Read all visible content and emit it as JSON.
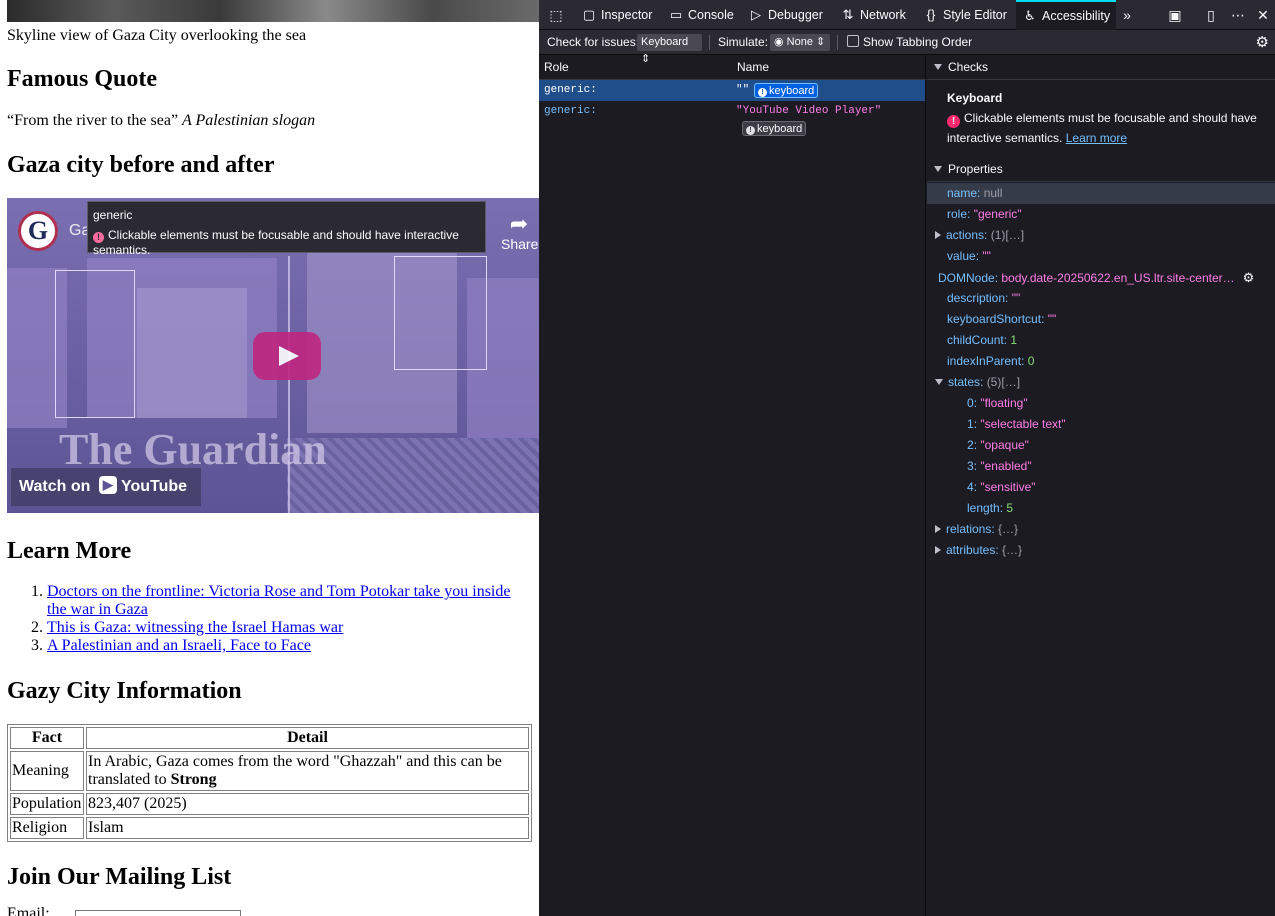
{
  "page": {
    "caption": "Skyline view of Gaza City overlooking the sea",
    "quote_heading": "Famous Quote",
    "quote_text": "“From the river to the sea”",
    "quote_attr": "A Palestinian slogan",
    "video_heading": "Gaza city before and after",
    "video": {
      "channel_letter": "G",
      "channel_name": "Ga",
      "share_label": "Share",
      "watermark": "The Guardian",
      "watch_on": "Watch on",
      "youtube": "YouTube"
    },
    "tooltip": {
      "title": "generic",
      "message": "Clickable elements must be focusable and should have interactive semantics."
    },
    "learn_heading": "Learn More",
    "links": [
      "Doctors on the frontline: Victoria Rose and Tom Potokar take you inside the war in Gaza",
      "This is Gaza: witnessing the Israel Hamas war",
      "A Palestinian and an Israeli, Face to Face"
    ],
    "info_heading": "Gazy City Information",
    "table": {
      "headers": [
        "Fact",
        "Detail"
      ],
      "rows": [
        {
          "fact": "Meaning",
          "detail": "In Arabic, Gaza comes from the word \"Ghazzah\" and this can be translated to ",
          "detail_bold": "Strong"
        },
        {
          "fact": "Population",
          "detail": "823,407 (2025)",
          "detail_bold": ""
        },
        {
          "fact": "Religion",
          "detail": "Islam",
          "detail_bold": ""
        }
      ]
    },
    "mailing_heading": "Join Our Mailing List",
    "email_label": "Email:"
  },
  "devtools": {
    "tabs": [
      "Inspector",
      "Console",
      "Debugger",
      "Network",
      "Style Editor",
      "Accessibility"
    ],
    "active_tab": "Accessibility",
    "toolbar": {
      "check_label": "Check for issues:",
      "check_value": "Keyboard",
      "simulate_label": "Simulate:",
      "simulate_value": "None",
      "tabbing_label": "Show Tabbing Order"
    },
    "tree": {
      "col_role": "Role",
      "col_name": "Name",
      "rows": [
        {
          "role": "generic:",
          "name": "\"\"",
          "badge": "keyboard"
        },
        {
          "role": "generic:",
          "name": "\"YouTube Video Player\"",
          "badge": "keyboard"
        }
      ]
    },
    "checks": {
      "header": "Checks",
      "title": "Keyboard",
      "message": "Clickable elements must be focusable and should have interactive semantics.",
      "learn_more": "Learn more"
    },
    "properties": {
      "header": "Properties",
      "items": [
        {
          "key": "name",
          "value": "null",
          "type": "g"
        },
        {
          "key": "role",
          "value": "\"generic\"",
          "type": "s"
        },
        {
          "key": "actions",
          "value": "(1)[…]",
          "type": "g"
        },
        {
          "key": "value",
          "value": "\"\"",
          "type": "s"
        },
        {
          "key": "DOMNode",
          "value": "body.date-20250622.en_US.ltr.site-center…",
          "type": "s"
        },
        {
          "key": "description",
          "value": "\"\"",
          "type": "s"
        },
        {
          "key": "keyboardShortcut",
          "value": "\"\"",
          "type": "s"
        },
        {
          "key": "childCount",
          "value": "1",
          "type": "n"
        },
        {
          "key": "indexInParent",
          "value": "0",
          "type": "n"
        },
        {
          "key": "states",
          "value": "(5)[…]",
          "type": "g"
        },
        {
          "key": "0",
          "value": "\"floating\"",
          "type": "s"
        },
        {
          "key": "1",
          "value": "\"selectable text\"",
          "type": "s"
        },
        {
          "key": "2",
          "value": "\"opaque\"",
          "type": "s"
        },
        {
          "key": "3",
          "value": "\"enabled\"",
          "type": "s"
        },
        {
          "key": "4",
          "value": "\"sensitive\"",
          "type": "s"
        },
        {
          "key": "length",
          "value": "5",
          "type": "n"
        },
        {
          "key": "relations",
          "value": "{…}",
          "type": "g"
        },
        {
          "key": "attributes",
          "value": "{…}",
          "type": "g"
        }
      ]
    },
    "colors": {
      "accent": "#00ddff",
      "selected_row": "#204e8a",
      "error": "#ff2a6d"
    }
  }
}
